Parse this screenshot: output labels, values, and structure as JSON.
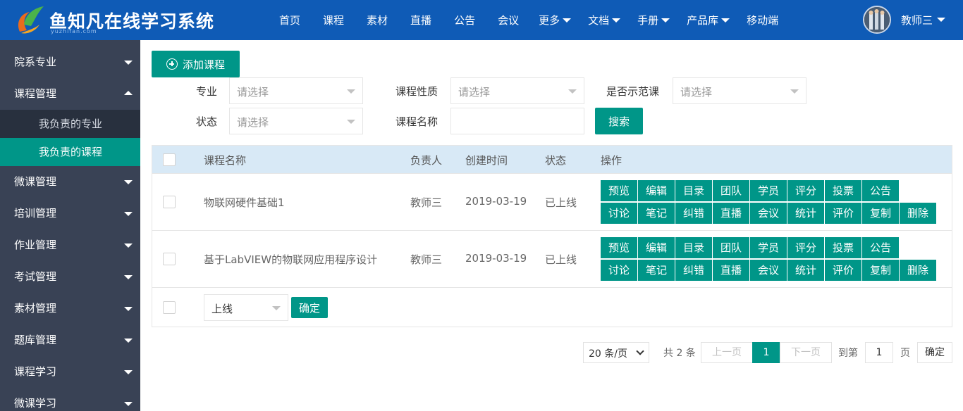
{
  "app": {
    "title": "鱼知凡在线学习系统",
    "subtitle": "yuzhifan.com"
  },
  "nav": {
    "items": [
      {
        "label": "首页",
        "dropdown": false
      },
      {
        "label": "课程",
        "dropdown": false
      },
      {
        "label": "素材",
        "dropdown": false
      },
      {
        "label": "直播",
        "dropdown": false
      },
      {
        "label": "公告",
        "dropdown": false
      },
      {
        "label": "会议",
        "dropdown": false
      },
      {
        "label": "更多",
        "dropdown": true
      },
      {
        "label": "文档",
        "dropdown": true
      },
      {
        "label": "手册",
        "dropdown": true
      },
      {
        "label": "产品库",
        "dropdown": true
      },
      {
        "label": "移动端",
        "dropdown": false
      }
    ]
  },
  "user": {
    "name": "教师三"
  },
  "sidebar": {
    "items": [
      {
        "label": "院系专业",
        "expanded": false
      },
      {
        "label": "课程管理",
        "expanded": true,
        "children": [
          {
            "label": "我负责的专业",
            "active": false
          },
          {
            "label": "我负责的课程",
            "active": true
          }
        ]
      },
      {
        "label": "微课管理",
        "expanded": false
      },
      {
        "label": "培训管理",
        "expanded": false
      },
      {
        "label": "作业管理",
        "expanded": false
      },
      {
        "label": "考试管理",
        "expanded": false
      },
      {
        "label": "素材管理",
        "expanded": false
      },
      {
        "label": "题库管理",
        "expanded": false
      },
      {
        "label": "课程学习",
        "expanded": false
      },
      {
        "label": "微课学习",
        "expanded": false
      }
    ]
  },
  "toolbar": {
    "add_label": "添加课程"
  },
  "filters": {
    "major_label": "专业",
    "nature_label": "课程性质",
    "demo_label": "是否示范课",
    "status_label": "状态",
    "name_label": "课程名称",
    "placeholder": "请选择",
    "name_value": "",
    "search_label": "搜索"
  },
  "table": {
    "headers": [
      "课程名称",
      "负责人",
      "创建时间",
      "状态",
      "操作"
    ],
    "rows": [
      {
        "name": "物联网硬件基础1",
        "owner": "教师三",
        "created": "2019-03-19",
        "status": "已上线"
      },
      {
        "name": "基于LabVIEW的物联网应用程序设计",
        "owner": "教师三",
        "created": "2019-03-19",
        "status": "已上线"
      }
    ],
    "actions_row1": [
      "预览",
      "编辑",
      "目录",
      "团队",
      "学员",
      "评分",
      "投票",
      "公告"
    ],
    "actions_row2": [
      "讨论",
      "笔记",
      "纠错",
      "直播",
      "会议",
      "统计",
      "评价",
      "复制",
      "删除"
    ],
    "batch_select": "上线",
    "batch_confirm": "确定"
  },
  "pagination": {
    "per_page": "20 条/页",
    "total": "共 2 条",
    "prev": "上一页",
    "current": "1",
    "next": "下一页",
    "goto_label": "到第",
    "goto_value": "1",
    "page_unit": "页",
    "confirm": "确定"
  },
  "colors": {
    "header_bg": "#0f5bb6",
    "sidebar_bg": "#394255",
    "accent": "#009688",
    "table_header_bg": "#d8e9f6"
  }
}
